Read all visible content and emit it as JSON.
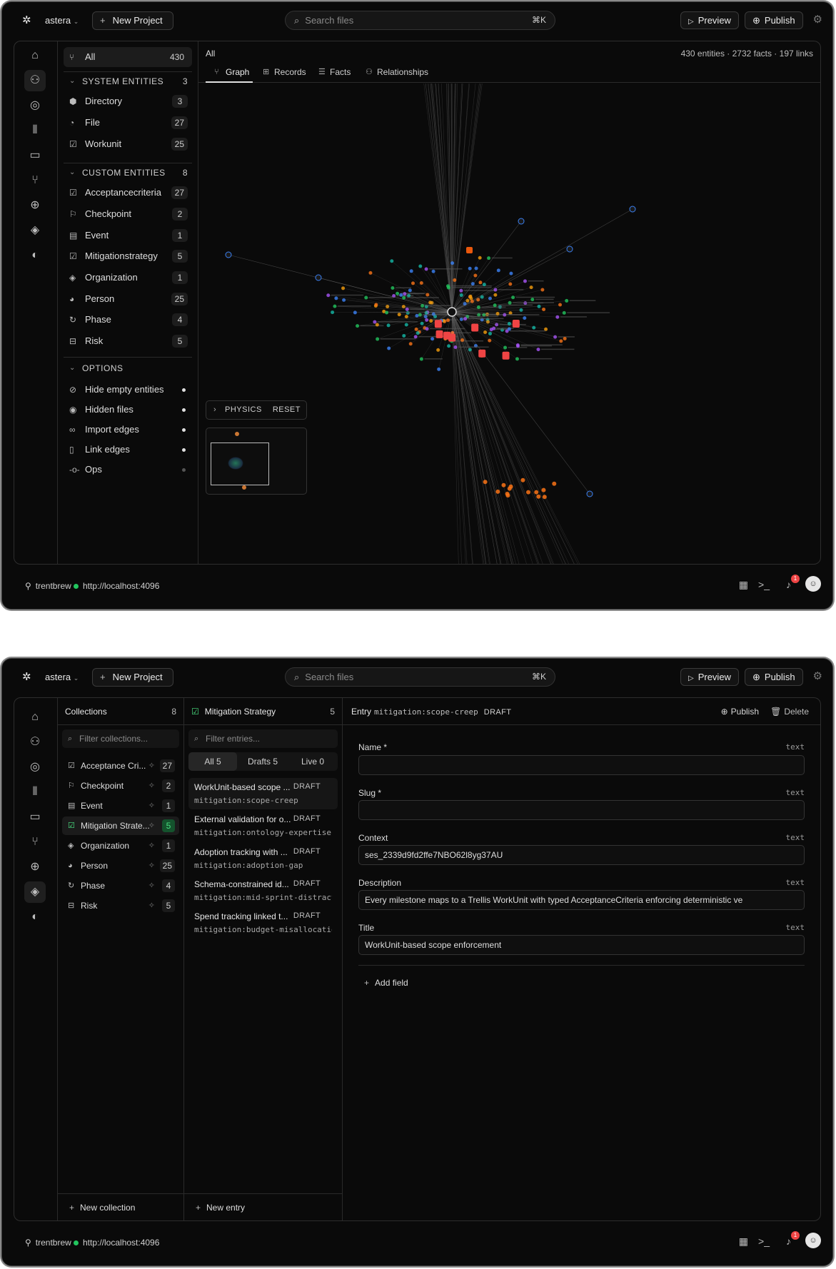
{
  "app": {
    "workspace": "astera",
    "new_project": "New Project",
    "search_placeholder": "Search files",
    "search_kbd": "⌘K",
    "preview": "Preview",
    "publish": "Publish"
  },
  "status": {
    "user": "trentbrew",
    "url": "http://localhost:4096",
    "notifications": "1"
  },
  "graph_view": {
    "sidebar": {
      "all": {
        "label": "All",
        "count": "430"
      },
      "system_section": {
        "label": "SYSTEM ENTITIES",
        "count": "3"
      },
      "system_items": [
        {
          "label": "Directory",
          "count": "3"
        },
        {
          "label": "File",
          "count": "27"
        },
        {
          "label": "Workunit",
          "count": "25"
        }
      ],
      "custom_section": {
        "label": "CUSTOM ENTITIES",
        "count": "8"
      },
      "custom_items": [
        {
          "label": "Acceptancecriteria",
          "count": "27"
        },
        {
          "label": "Checkpoint",
          "count": "2"
        },
        {
          "label": "Event",
          "count": "1"
        },
        {
          "label": "Mitigationstrategy",
          "count": "5"
        },
        {
          "label": "Organization",
          "count": "1"
        },
        {
          "label": "Person",
          "count": "25"
        },
        {
          "label": "Phase",
          "count": "4"
        },
        {
          "label": "Risk",
          "count": "5"
        }
      ],
      "options_section": {
        "label": "OPTIONS"
      },
      "options": [
        {
          "label": "Hide empty entities"
        },
        {
          "label": "Hidden files"
        },
        {
          "label": "Import edges"
        },
        {
          "label": "Link edges"
        },
        {
          "label": "Ops"
        }
      ]
    },
    "title": "All",
    "stats": "430 entities · 2732 facts · 197 links",
    "tabs": [
      "Graph",
      "Records",
      "Facts",
      "Relationships"
    ],
    "physics": "PHYSICS",
    "reset": "RESET"
  },
  "cms_view": {
    "collections": {
      "title": "Collections",
      "count": "8",
      "filter_placeholder": "Filter collections...",
      "items": [
        {
          "label": "Acceptance Cri...",
          "count": "27"
        },
        {
          "label": "Checkpoint",
          "count": "2"
        },
        {
          "label": "Event",
          "count": "1"
        },
        {
          "label": "Mitigation Strate...",
          "count": "5"
        },
        {
          "label": "Organization",
          "count": "1"
        },
        {
          "label": "Person",
          "count": "25"
        },
        {
          "label": "Phase",
          "count": "4"
        },
        {
          "label": "Risk",
          "count": "5"
        }
      ],
      "new": "New collection"
    },
    "entries": {
      "title": "Mitigation Strategy",
      "count": "5",
      "filter_placeholder": "Filter entries...",
      "seg": [
        "All 5",
        "Drafts 5",
        "Live 0"
      ],
      "items": [
        {
          "title": "WorkUnit-based scope ...",
          "status": "DRAFT",
          "slug": "mitigation:scope-creep"
        },
        {
          "title": "External validation for o...",
          "status": "DRAFT",
          "slug": "mitigation:ontology-expertise"
        },
        {
          "title": "Adoption tracking with ...",
          "status": "DRAFT",
          "slug": "mitigation:adoption-gap"
        },
        {
          "title": "Schema-constrained id...",
          "status": "DRAFT",
          "slug": "mitigation:mid-sprint-distract…"
        },
        {
          "title": "Spend tracking linked t...",
          "status": "DRAFT",
          "slug": "mitigation:budget-misallocation"
        }
      ],
      "new": "New entry"
    },
    "editor": {
      "label": "Entry",
      "slug": "mitigation:scope-creep",
      "status": "DRAFT",
      "publish": "Publish",
      "delete": "Delete",
      "fields": [
        {
          "label": "Name *",
          "type": "text",
          "value": ""
        },
        {
          "label": "Slug *",
          "type": "text",
          "value": ""
        },
        {
          "label": "Context",
          "type": "text",
          "value": "ses_2339d9fd2ffe7NBO62l8yg37AU"
        },
        {
          "label": "Description",
          "type": "text",
          "value": "Every milestone maps to a Trellis WorkUnit with typed AcceptanceCriteria enforcing deterministic ve"
        },
        {
          "label": "Title",
          "type": "text",
          "value": "WorkUnit-based scope enforcement"
        }
      ],
      "add_field": "Add field"
    }
  }
}
